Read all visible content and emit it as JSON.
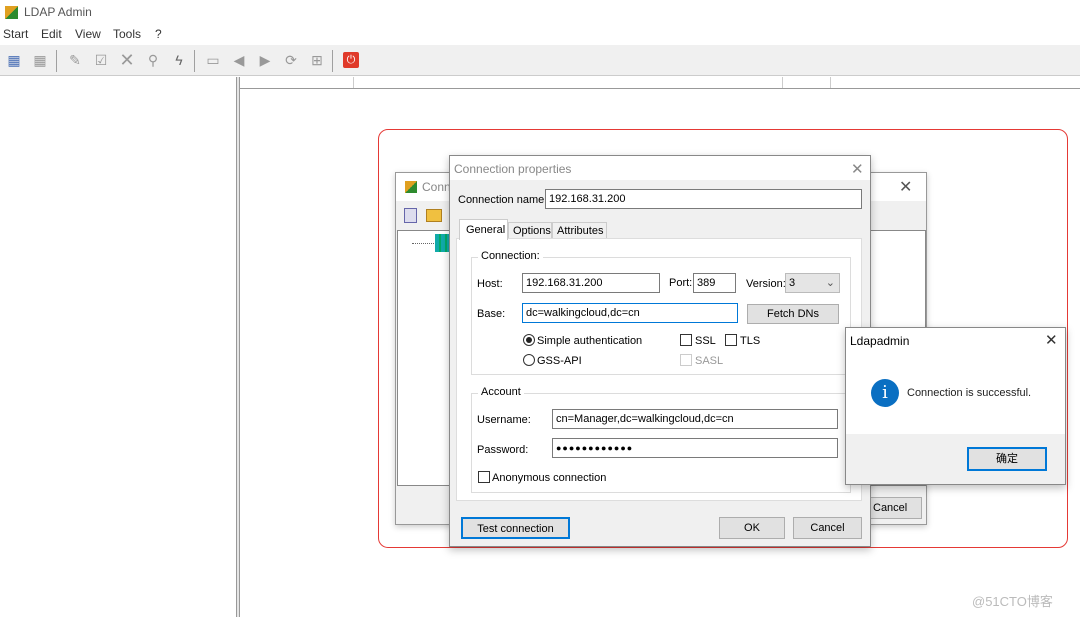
{
  "app": {
    "title": "LDAP Admin"
  },
  "menu": [
    "Start",
    "Edit",
    "View",
    "Tools",
    "?"
  ],
  "toolbar": [
    "connect-icon",
    "disconnect-icon",
    "edit-icon",
    "save-icon",
    "delete-icon",
    "search-icon",
    "lightning-icon",
    "book-icon",
    "back-icon",
    "forward-icon",
    "refresh-icon",
    "schema-icon",
    "exit-icon"
  ],
  "back_dialog": {
    "title": "Conn",
    "cancel": "Cancel"
  },
  "dialog": {
    "title": "Connection properties",
    "connection_name_label": "Connection name:",
    "connection_name": "192.168.31.200",
    "tabs": [
      "General",
      "Options",
      "Attributes"
    ],
    "active_tab": "General",
    "connection_group": "Connection:",
    "host_label": "Host:",
    "host": "192.168.31.200",
    "port_label": "Port:",
    "port": "389",
    "version_label": "Version:",
    "version": "3",
    "base_label": "Base:",
    "base": "dc=walkingcloud,dc=cn",
    "fetch_dns": "Fetch DNs",
    "simple_auth": "Simple authentication",
    "gss_api": "GSS-API",
    "auth_selected": "Simple authentication",
    "ssl": "SSL",
    "tls": "TLS",
    "sasl": "SASL",
    "account_group": "Account",
    "username_label": "Username:",
    "username": "cn=Manager,dc=walkingcloud,dc=cn",
    "password_label": "Password:",
    "password": "●●●●●●●●●●●●",
    "anonymous": "Anonymous connection",
    "test_connection": "Test connection",
    "ok": "OK",
    "cancel": "Cancel"
  },
  "message_box": {
    "title": "Ldapadmin",
    "text": "Connection is successful.",
    "ok": "确定"
  },
  "watermark": "@51CTO博客",
  "colors": {
    "highlight_border": "#e53935",
    "info_icon": "#0a6fc2",
    "focus_border": "#0078d7"
  }
}
